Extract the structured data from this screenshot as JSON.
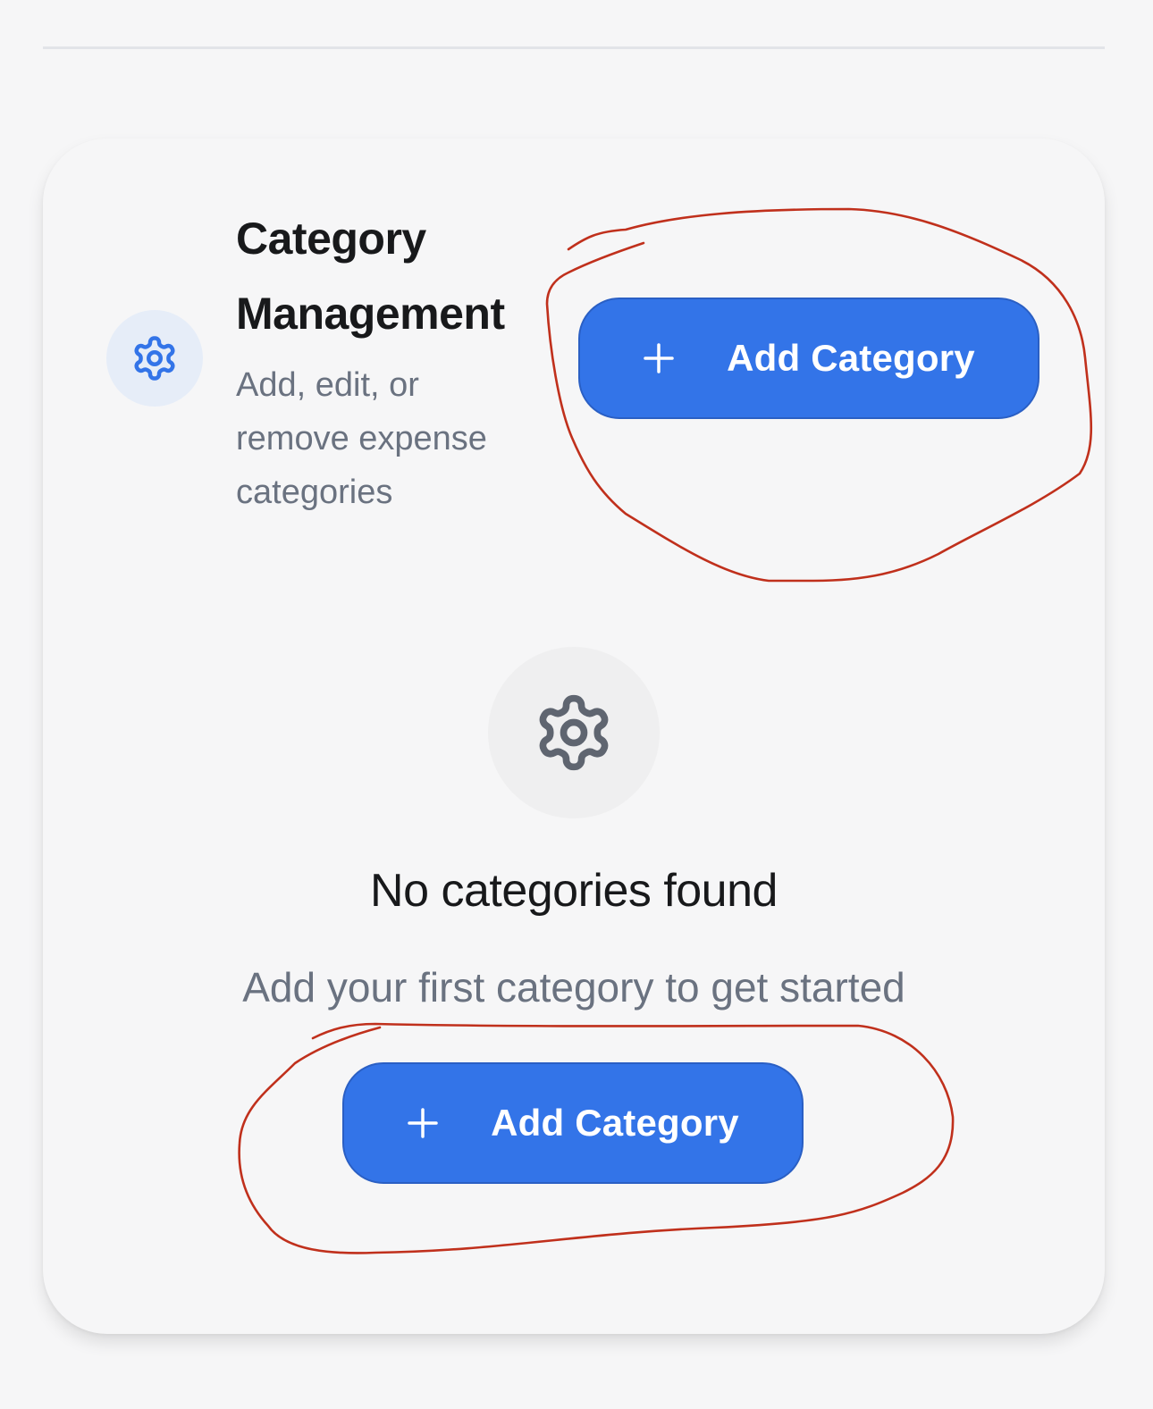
{
  "header": {
    "title_line1": "Category",
    "title_line2": "Management",
    "subtitle_line1": "Add, edit, or",
    "subtitle_line2": "remove expense",
    "subtitle_line3": "categories",
    "icon": "gear-icon",
    "add_button": {
      "icon": "plus-icon",
      "label": "Add Category"
    }
  },
  "empty_state": {
    "icon": "gear-icon",
    "title": "No categories found",
    "message": "Add your first category to get started",
    "add_button": {
      "icon": "plus-icon",
      "label": "Add Category"
    }
  },
  "colors": {
    "primary": "#3374e8",
    "annotation": "#c0301c",
    "text": "#18191b",
    "muted": "#6a7280"
  }
}
